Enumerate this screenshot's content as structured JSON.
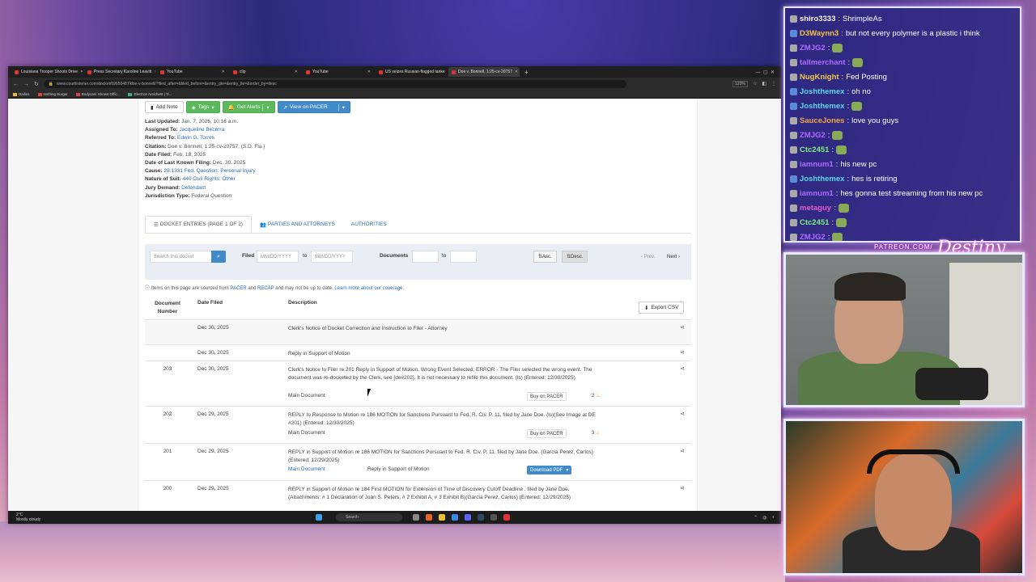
{
  "browser": {
    "tabs": [
      {
        "label": "Louisiana Trooper Shoots Drive",
        "active": false
      },
      {
        "label": "Press Secretary Karoline Leavitt",
        "active": false
      },
      {
        "label": "YouTube",
        "active": false
      },
      {
        "label": "clip",
        "active": false
      },
      {
        "label": "YouTube",
        "active": false
      },
      {
        "label": "US seizes Russian-flagged tanke",
        "active": false
      },
      {
        "label": "Doe v. Bonnell, 1:25-cv-20757",
        "active": true
      }
    ],
    "url": "www.courtlistener.com/docket/69650487/doe-v-bonnell/?filed_after=&filed_before=&entry_gte=&entry_lte=&order_by=desc",
    "zoom": "120%",
    "bookmarks": [
      "Dailies",
      "Nothing Burger",
      "Bodycam Shows Offic...",
      "Electron Antichest | Ti..."
    ]
  },
  "docket": {
    "buttons": {
      "add_note": "Add Note",
      "tags": "Tags",
      "get_alerts": "Get Alerts",
      "view_pacer": "View on PACER"
    },
    "meta": [
      {
        "label": "Last Updated:",
        "value": "Jan. 7, 2026, 10:16 a.m.",
        "link": false
      },
      {
        "label": "Assigned To:",
        "value": "Jacqueline Becerra",
        "link": true
      },
      {
        "label": "Referred To:",
        "value": "Edwin G. Torres",
        "link": true
      },
      {
        "label": "Citation:",
        "value": "Doe v. Bonnell, 1:25-cv-20757, (S.D. Fla.)",
        "link": false
      },
      {
        "label": "Date Filed:",
        "value": "Feb. 18, 2025",
        "link": false
      },
      {
        "label": "Date of Last Known Filing:",
        "value": "Dec. 30, 2025",
        "link": false
      },
      {
        "label": "Cause:",
        "value": "28:1331 Fed. Question: Personal Injury",
        "link": true
      },
      {
        "label": "Nature of Suit:",
        "value": "440 Civil Rights: Other",
        "link": true
      },
      {
        "label": "Jury Demand:",
        "value": "Defendant",
        "link": true
      },
      {
        "label": "Jurisdiction Type:",
        "value": "Federal Question",
        "link": false
      }
    ],
    "tabs": [
      "DOCKET ENTRIES (PAGE 1 OF 2)",
      "PARTIES AND ATTORNEYS",
      "AUTHORITIES"
    ],
    "filter": {
      "search_placeholder": "Search this docket",
      "filed_label": "Filed",
      "date_placeholder": "MM/DD/YYYY",
      "to": "to",
      "documents_label": "Documents",
      "asc": "Asc.",
      "desc": "Desc.",
      "prev": "Prev.",
      "next": "Next"
    },
    "note_text": "Items on this page are sourced from",
    "note_pacer": "PACER",
    "note_and": "and",
    "note_recap": "RECAP",
    "note_tail": "and may not be up to date.",
    "note_link": "Learn more about our coverage.",
    "columns": {
      "num1": "Document",
      "num2": "Number",
      "date": "Date Filed",
      "desc": "Description",
      "export": "Export CSV"
    },
    "rows": [
      {
        "num": "",
        "date": "Dec 30, 2025",
        "desc": "Clerk's Notice of Docket Correction and Instruction to Filer - Attorney"
      },
      {
        "num": "",
        "date": "Dec 30, 2025",
        "desc": "Reply in Support of Motion"
      },
      {
        "num": "203",
        "date": "Dec 30, 2025",
        "desc": "Clerk's Notice to Filer re 201 Reply in Support of Motion. Wrong Event Selected; ERROR - The Filer selected the wrong event. The document was re-docketed by the Clerk, see [de#202]. It is not necessary to refile this document. (ls) (Entered: 12/30/2025)",
        "main": "Main Document",
        "buy": "Buy on PACER",
        "count": "2"
      },
      {
        "num": "202",
        "date": "Dec 29, 2025",
        "desc": "REPLY to Response to Motion re 186 MOTION for Sanctions Pursuant to Fed. R. Civ. P. 11. filed by Jane Doe. (ls)(See Image at DE #201) (Entered: 12/30/2025)",
        "main": "Main Document",
        "buy": "Buy on PACER",
        "count": "3"
      },
      {
        "num": "201",
        "date": "Dec 29, 2025",
        "desc": "REPLY in Support of Motion re 186 MOTION for Sanctions Pursuant to Fed. R. Civ. P. 11. filed by Jane Doe. (Garcia Perez, Carlos) (Entered: 12/29/2025)",
        "main": "Main Document",
        "attach": "Reply in Support of Motion",
        "download": "Download PDF"
      },
      {
        "num": "200",
        "date": "Dec 29, 2025",
        "desc": "REPLY in Support of Motion re 184 First MOTION for Extension of Time of Discovery Cutoff Deadline . filed by Jane Doe. (Attachments: # 1 Declaration of Joan S. Peters, # 2 Exhibit A, # 3 Exhibit B)(Garcia Perez, Carlos) (Entered: 12/29/2025)"
      }
    ]
  },
  "taskbar": {
    "temp": "2°C",
    "weather": "Mostly cloudy",
    "search": "Search"
  },
  "chat": [
    {
      "user": "shiro3333",
      "text": "ShrimpleAs",
      "color": "#ffffff",
      "badge": "b3"
    },
    {
      "user": "D3Waynn3",
      "text": "but not every polymer is a plastic i think",
      "color": "#f2c744",
      "badge": "b1"
    },
    {
      "user": "ZMJG2",
      "text": "",
      "color": "#b06cff",
      "badge": "b3"
    },
    {
      "user": "tallmerchant",
      "text": "",
      "color": "#b06cff",
      "badge": "b3"
    },
    {
      "user": "NugKnight",
      "text": "Fed Posting",
      "color": "#f2c744",
      "badge": "b3"
    },
    {
      "user": "Joshthemex",
      "text": "oh no",
      "color": "#5ed8e8",
      "badge": "b1"
    },
    {
      "user": "Joshthemex",
      "text": "",
      "color": "#5ed8e8",
      "badge": "b1"
    },
    {
      "user": "SauceJones",
      "text": "love you guys",
      "color": "#f2a64a",
      "badge": "b3"
    },
    {
      "user": "ZMJG2",
      "text": "",
      "color": "#b06cff",
      "badge": "b3"
    },
    {
      "user": "Ctc2451",
      "text": "",
      "color": "#7cf07c",
      "badge": "b3"
    },
    {
      "user": "iamnum1",
      "text": "his new pc",
      "color": "#b06cff",
      "badge": "b3"
    },
    {
      "user": "Joshthemex",
      "text": "hes is retiring",
      "color": "#5ed8e8",
      "badge": "b1"
    },
    {
      "user": "iamnum1",
      "text": "hes gonna test streaming from his new pc",
      "color": "#b06cff",
      "badge": "b3"
    },
    {
      "user": "metaguy",
      "text": "",
      "color": "#e85ad8",
      "badge": "b3"
    },
    {
      "user": "Ctc2451",
      "text": "",
      "color": "#7cf07c",
      "badge": "b3"
    },
    {
      "user": "ZMJG2",
      "text": "",
      "color": "#b06cff",
      "badge": "b3"
    }
  ],
  "overlay": {
    "patreon": "PATREON.COM/"
  }
}
